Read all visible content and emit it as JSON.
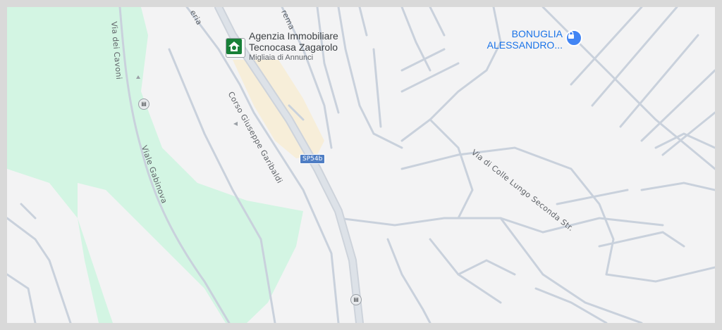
{
  "map": {
    "colors": {
      "background": "#f3f3f4",
      "park": "#d3f5e3",
      "road": "#c9d1dc",
      "main_road": "#cdd3db",
      "commercial": "#f7eed9",
      "poi_blue": "#1a73e8",
      "poi_green": "#188038"
    },
    "streets": {
      "via_dei_cavoni": "Via dei Cavoni",
      "viale_gabinova": "Viale Gabinova",
      "corso_garibaldi": "Corso Giuseppe Garibaldi",
      "via_colle_lungo": "Via di Colle Lungo Seconda Str.",
      "partial_top_left": "eria",
      "partial_top": "rema"
    },
    "road_shield": "SP54b",
    "pois": {
      "agency": {
        "name_line1": "Agenzia Immobiliare",
        "name_line2": "Tecnocasa Zagarolo",
        "subtitle": "Migliaia di Annunci",
        "icon": "home-icon"
      },
      "bonuglia": {
        "name_line1": "BONUGLIA",
        "name_line2": "ALESSANDRO...",
        "icon": "lock-icon"
      }
    },
    "transit_stops": [
      "bus-stop-icon",
      "bus-stop-icon"
    ]
  }
}
